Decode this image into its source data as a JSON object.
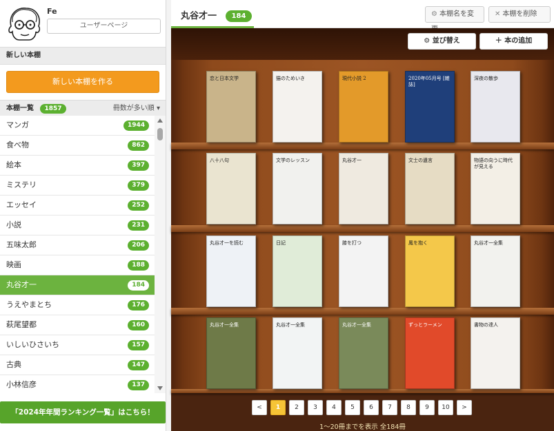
{
  "profile": {
    "username": "Fe",
    "user_page_label": "ユーザーページ"
  },
  "new_shelf": {
    "section_title": "新しい本棚",
    "create_button": "新しい本棚を作る"
  },
  "shelf_list": {
    "title": "本棚一覧",
    "count": "1857",
    "sort_label": "冊数が多い順",
    "items": [
      {
        "label": "マンガ",
        "count": "1944"
      },
      {
        "label": "食べ物",
        "count": "862"
      },
      {
        "label": "絵本",
        "count": "397"
      },
      {
        "label": "ミステリ",
        "count": "379"
      },
      {
        "label": "エッセイ",
        "count": "252"
      },
      {
        "label": "小説",
        "count": "231"
      },
      {
        "label": "五味太郎",
        "count": "206"
      },
      {
        "label": "映画",
        "count": "188"
      },
      {
        "label": "丸谷才一",
        "count": "184"
      },
      {
        "label": "うえやまとち",
        "count": "176"
      },
      {
        "label": "萩尾望都",
        "count": "160"
      },
      {
        "label": "いしいひさいち",
        "count": "157"
      },
      {
        "label": "古典",
        "count": "147"
      },
      {
        "label": "小林信彦",
        "count": "137"
      }
    ]
  },
  "ranking_banner": "「2024年年間ランキング一覧」はこちら！",
  "main": {
    "shelf_title": "丸谷才一",
    "shelf_count": "184",
    "rename_label": "本棚名を変更",
    "delete_label": "本棚を削除",
    "sort_label": "並び替え",
    "add_label": "本の追加"
  },
  "books": [
    {
      "title": "恋と日本文学",
      "color": "#c9b48a"
    },
    {
      "title": "猫のためいき",
      "color": "#f4f2ee"
    },
    {
      "title": "現代小説 2",
      "color": "#e39a2a"
    },
    {
      "title": "2020年05月号 [雑誌]",
      "color": "#1f3f7a"
    },
    {
      "title": "深夜の散歩",
      "color": "#e8e8ee"
    },
    {
      "title": "八十八句",
      "color": "#eae4d0"
    },
    {
      "title": "文学のレッスン",
      "color": "#f1f1ee"
    },
    {
      "title": "丸谷才一",
      "color": "#efeae0"
    },
    {
      "title": "文士の遺言",
      "color": "#e6dcc4"
    },
    {
      "title": "物語の向うに時代が見える",
      "color": "#f3efe6"
    },
    {
      "title": "丸谷才一を読む",
      "color": "#eef2f6"
    },
    {
      "title": "日記",
      "color": "#e0ecd8"
    },
    {
      "title": "膝を打つ",
      "color": "#f3f3f3"
    },
    {
      "title": "鳳を抱く",
      "color": "#f4c84a"
    },
    {
      "title": "丸谷才一全集",
      "color": "#f2f2ee"
    },
    {
      "title": "丸谷才一全集",
      "color": "#6e7a48"
    },
    {
      "title": "丸谷才一全集",
      "color": "#f2f4f4"
    },
    {
      "title": "丸谷才一全集",
      "color": "#7a8a5a"
    },
    {
      "title": "ずっとラーメン",
      "color": "#e14a2a"
    },
    {
      "title": "書物の達人",
      "color": "#f4f2ee"
    }
  ],
  "pagination": {
    "prev": "<",
    "next": ">",
    "pages": [
      "1",
      "2",
      "3",
      "4",
      "5",
      "6",
      "7",
      "8",
      "9",
      "10"
    ],
    "current": "1"
  },
  "range_text": "1〜20冊までを表示 全184冊"
}
